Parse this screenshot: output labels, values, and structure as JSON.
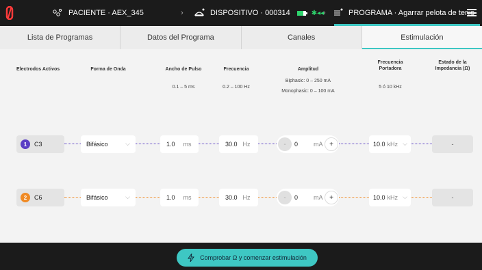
{
  "topbar": {
    "patient": "PACIENTE · AEX_345",
    "device": "DISPOSITIVO · 000314",
    "program": "PROGRAMA · Agarrar pelota de tenis",
    "accent": "#3ec7c3",
    "battery_color": "#2ed36c"
  },
  "tabs": [
    {
      "label": "Lista de Programas"
    },
    {
      "label": "Datos del Programa"
    },
    {
      "label": "Canales"
    },
    {
      "label": "Estimulación"
    }
  ],
  "columns": {
    "electrodes": "Electrodos Activos",
    "waveform": "Forma de Onda",
    "pulse_width": "Ancho de Pulso",
    "pulse_width_range": "0.1 – 5 ms",
    "frequency": "Frecuencia",
    "frequency_range": "0.2 – 100 Hz",
    "amplitude": "Amplitud",
    "amplitude_range_bi": "Biphasic: 0 – 250 mA",
    "amplitude_range_mono": "Monophasic: 0 – 100 mA",
    "carrier": "Frecuencia\nPortadora",
    "carrier_range": "5 ó 10 kHz",
    "impedance": "Estado de la\nImpedancia (Ω)"
  },
  "rows": [
    {
      "num": "1",
      "electrode": "C3",
      "color": "#5b3fc4",
      "waveform": "Bifásico",
      "pulse_width": "1.0",
      "pulse_unit": "ms",
      "frequency": "30.0",
      "freq_unit": "Hz",
      "minus": "-",
      "amplitude": "0",
      "amp_unit": "mA",
      "plus": "+",
      "carrier": "10.0",
      "carrier_unit": "kHz",
      "impedance": "-"
    },
    {
      "num": "2",
      "electrode": "C6",
      "color": "#f08a24",
      "waveform": "Bifásico",
      "pulse_width": "1.0",
      "pulse_unit": "ms",
      "frequency": "30.0",
      "freq_unit": "Hz",
      "minus": "-",
      "amplitude": "0",
      "amp_unit": "mA",
      "plus": "+",
      "carrier": "10.0",
      "carrier_unit": "kHz",
      "impedance": "-"
    }
  ],
  "footer": {
    "start_label": "Comprobar Ω y comenzar estimulación"
  }
}
